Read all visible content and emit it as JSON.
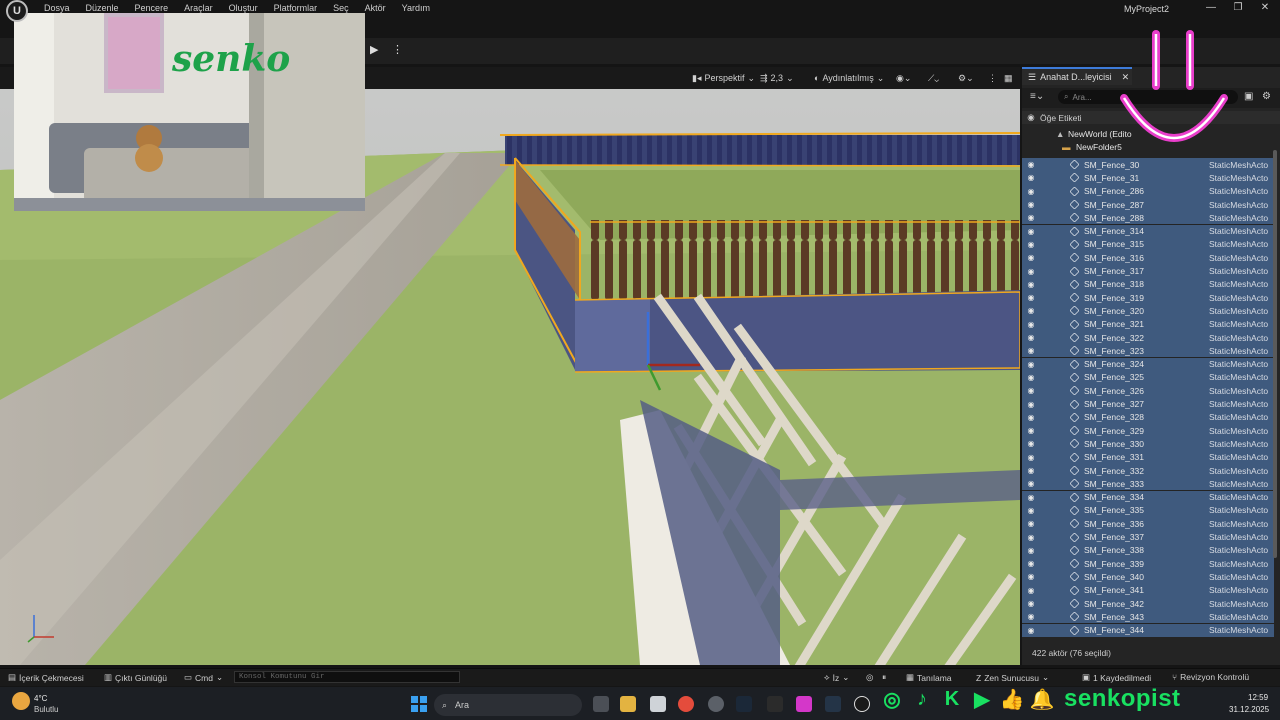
{
  "menu": {
    "items": [
      "Dosya",
      "Düzenle",
      "Pencere",
      "Araçlar",
      "Oluştur",
      "Platformlar",
      "Seç",
      "Aktör",
      "Yardım"
    ],
    "project_name": "MyProject2",
    "window_controls": [
      "—",
      "❐",
      "✕"
    ]
  },
  "viewport_toolbar": {
    "perspective": "Perspektif",
    "camera_speed": "2,3",
    "lighting": "Aydınlatılmış"
  },
  "outliner": {
    "tab_title": "Anahat D...leyicisi",
    "search_placeholder": "Ara...",
    "column_header": "Öğe Etiketi",
    "world_label": "NewWorld (Edito",
    "folder_label": "NewFolder5",
    "rows": [
      {
        "label": "SM_Fence_30",
        "type": "StaticMeshActo"
      },
      {
        "label": "SM_Fence_31",
        "type": "StaticMeshActo"
      },
      {
        "label": "SM_Fence_286",
        "type": "StaticMeshActo"
      },
      {
        "label": "SM_Fence_287",
        "type": "StaticMeshActo"
      },
      {
        "label": "SM_Fence_288",
        "type": "StaticMeshActo"
      },
      {
        "label": "SM_Fence_314",
        "type": "StaticMeshActo"
      },
      {
        "label": "SM_Fence_315",
        "type": "StaticMeshActo"
      },
      {
        "label": "SM_Fence_316",
        "type": "StaticMeshActo"
      },
      {
        "label": "SM_Fence_317",
        "type": "StaticMeshActo"
      },
      {
        "label": "SM_Fence_318",
        "type": "StaticMeshActo"
      },
      {
        "label": "SM_Fence_319",
        "type": "StaticMeshActo"
      },
      {
        "label": "SM_Fence_320",
        "type": "StaticMeshActo"
      },
      {
        "label": "SM_Fence_321",
        "type": "StaticMeshActo"
      },
      {
        "label": "SM_Fence_322",
        "type": "StaticMeshActo"
      },
      {
        "label": "SM_Fence_323",
        "type": "StaticMeshActo"
      },
      {
        "label": "SM_Fence_324",
        "type": "StaticMeshActo"
      },
      {
        "label": "SM_Fence_325",
        "type": "StaticMeshActo"
      },
      {
        "label": "SM_Fence_326",
        "type": "StaticMeshActo"
      },
      {
        "label": "SM_Fence_327",
        "type": "StaticMeshActo"
      },
      {
        "label": "SM_Fence_328",
        "type": "StaticMeshActo"
      },
      {
        "label": "SM_Fence_329",
        "type": "StaticMeshActo"
      },
      {
        "label": "SM_Fence_330",
        "type": "StaticMeshActo"
      },
      {
        "label": "SM_Fence_331",
        "type": "StaticMeshActo"
      },
      {
        "label": "SM_Fence_332",
        "type": "StaticMeshActo"
      },
      {
        "label": "SM_Fence_333",
        "type": "StaticMeshActo"
      },
      {
        "label": "SM_Fence_334",
        "type": "StaticMeshActo"
      },
      {
        "label": "SM_Fence_335",
        "type": "StaticMeshActo"
      },
      {
        "label": "SM_Fence_336",
        "type": "StaticMeshActo"
      },
      {
        "label": "SM_Fence_337",
        "type": "StaticMeshActo"
      },
      {
        "label": "SM_Fence_338",
        "type": "StaticMeshActo"
      },
      {
        "label": "SM_Fence_339",
        "type": "StaticMeshActo"
      },
      {
        "label": "SM_Fence_340",
        "type": "StaticMeshActo"
      },
      {
        "label": "SM_Fence_341",
        "type": "StaticMeshActo"
      },
      {
        "label": "SM_Fence_342",
        "type": "StaticMeshActo"
      },
      {
        "label": "SM_Fence_343",
        "type": "StaticMeshActo"
      },
      {
        "label": "SM_Fence_344",
        "type": "StaticMeshActo"
      }
    ],
    "footer": "422 aktör (76 seçildi)"
  },
  "statusbar": {
    "content_drawer": "İçerik Çekmecesi",
    "output_log": "Çıktı Günlüğü",
    "cmd": "Cmd",
    "console_placeholder": "Konsol Komutunu Gir",
    "trace": "İz",
    "derive": "Tanılama",
    "zen_server": "Zen Sunucusu",
    "saved": "1 Kaydedilmedi",
    "revision_control": "Revizyon Kontrolü"
  },
  "taskbar": {
    "weather_temp": "4°C",
    "weather_desc": "Bulutlu",
    "search_label": "Ara",
    "time": "12:59",
    "date": "31.12.2025"
  },
  "webcam": {
    "wall_text": "senko"
  },
  "overlay": {
    "handle": "senkopist"
  },
  "colors": {
    "accent_blue": "#3d7bd9",
    "selection_row": "#3f5a7e",
    "brand_green": "#19e061",
    "smile_pink": "#e93ecb"
  }
}
